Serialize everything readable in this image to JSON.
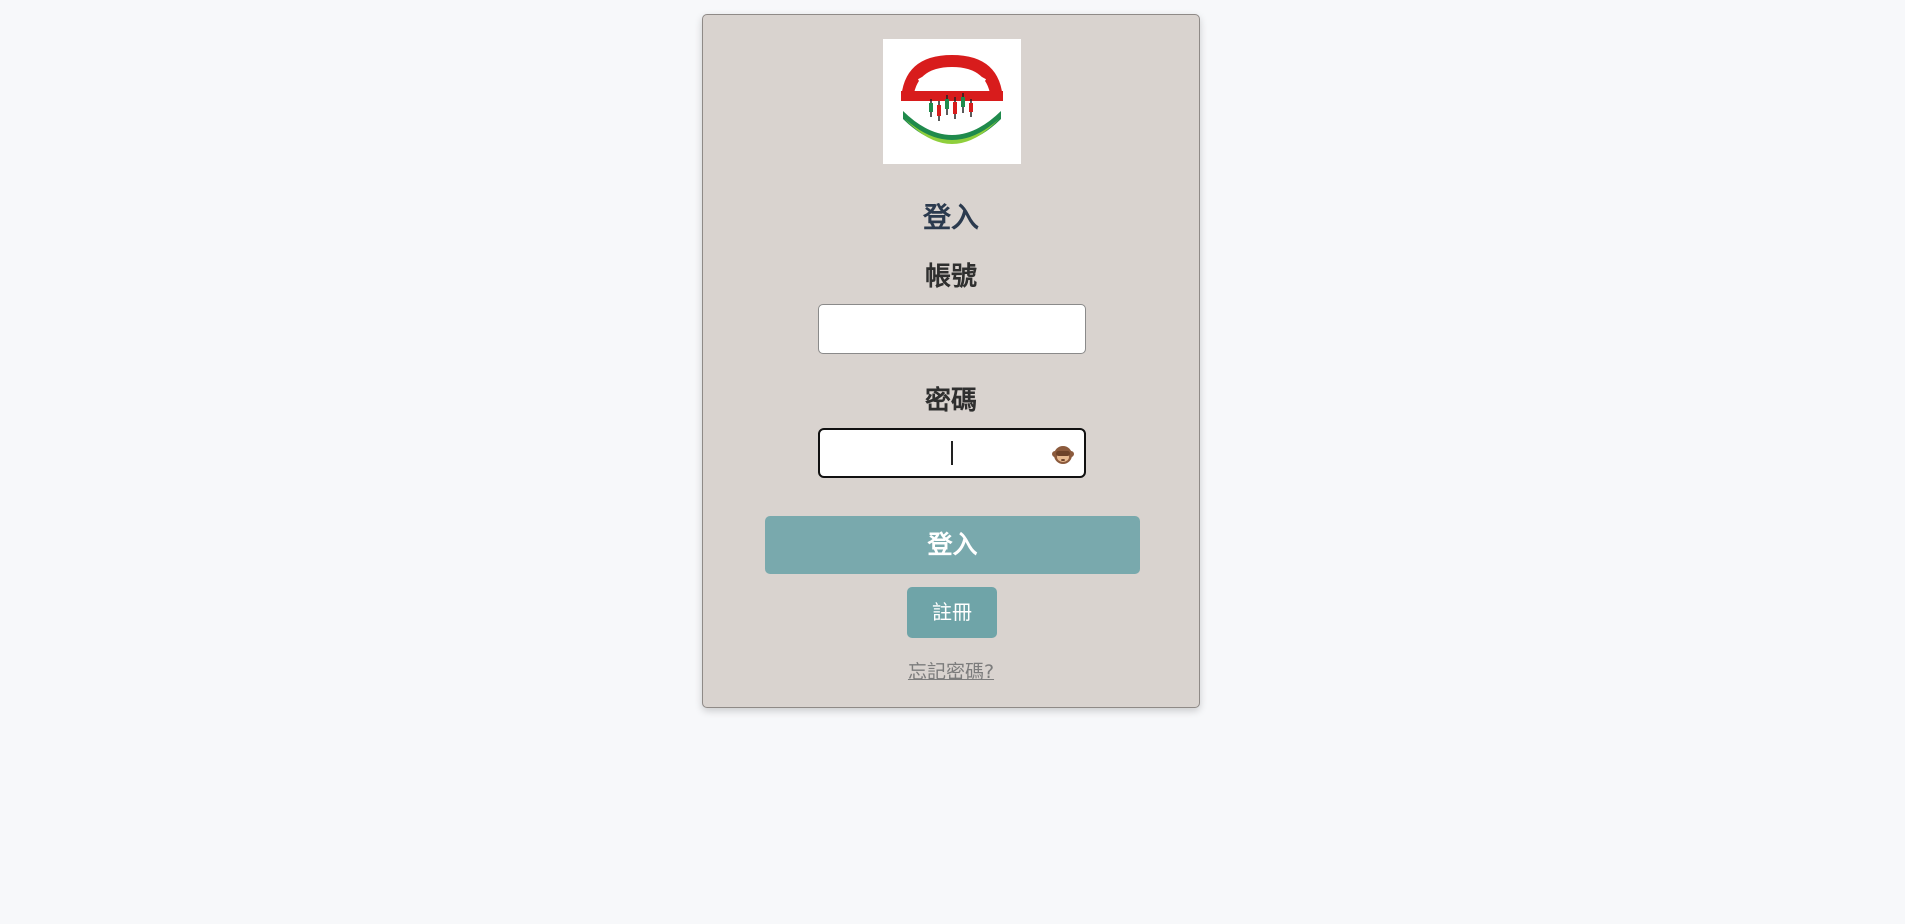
{
  "login_card": {
    "logo": {
      "icon": "candlestick-globe-logo",
      "colors": {
        "red": "#d81c1c",
        "green": "#1f8a4c",
        "lime": "#8fcf3c"
      }
    },
    "title": "登入",
    "account_label": "帳號",
    "account_value": "",
    "password_label": "密碼",
    "password_value": "",
    "password_toggle_icon": "see-no-evil-monkey-icon",
    "login_button": "登入",
    "register_button": "註冊",
    "forgot_link": "忘記密碼?",
    "colors": {
      "card_background": "#d9d3cf",
      "page_background": "#f7f8fa",
      "button_primary": "#79a9ad",
      "title_text": "#2b3a4e"
    }
  }
}
